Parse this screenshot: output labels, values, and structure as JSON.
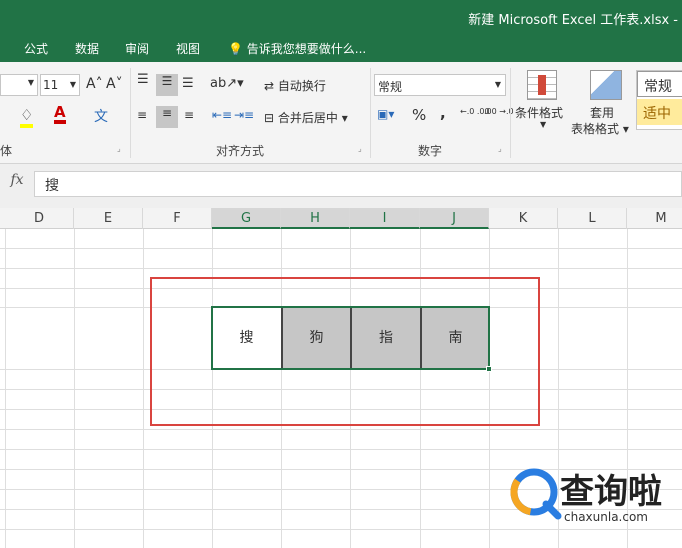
{
  "window": {
    "title": "新建 Microsoft Excel 工作表.xlsx -"
  },
  "menu": {
    "tabs": [
      "公式",
      "数据",
      "审阅",
      "视图"
    ],
    "tell_me": "告诉我您想要做什么..."
  },
  "ribbon": {
    "font": {
      "size": "11",
      "group_label": "体"
    },
    "alignment": {
      "wrap_text": "自动换行",
      "merge_center": "合并后居中",
      "group_label": "对齐方式"
    },
    "number": {
      "format": "常规",
      "percent": "%",
      "comma": ",",
      "group_label": "数字",
      "inc_decimal": "←.0 .00",
      "dec_decimal": ".00 →.0"
    },
    "styles": {
      "conditional": "条件格式",
      "table_format_1": "套用",
      "table_format_2": "表格格式",
      "style_normal": "常规",
      "style_neutral": "适中"
    }
  },
  "formula_bar": {
    "fx": "fx",
    "value": "搜"
  },
  "columns": [
    "D",
    "E",
    "F",
    "G",
    "H",
    "I",
    "J",
    "K",
    "L",
    "M"
  ],
  "cells": [
    {
      "col": "G",
      "value": "搜"
    },
    {
      "col": "H",
      "value": "狗"
    },
    {
      "col": "I",
      "value": "指"
    },
    {
      "col": "J",
      "value": "南"
    }
  ],
  "watermark": {
    "name": "查询啦",
    "domain": "chaxunla.com"
  },
  "colors": {
    "excel_green": "#217346",
    "highlight_red": "#d9443f",
    "cell_fill": "#c6c6c6",
    "neutral_style": "#ffeb9c"
  }
}
